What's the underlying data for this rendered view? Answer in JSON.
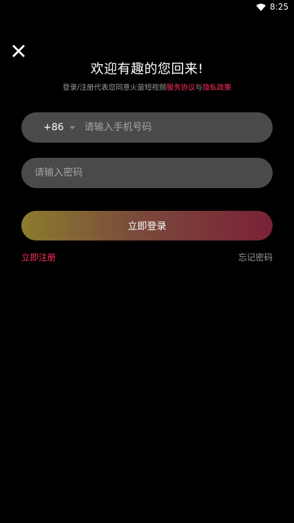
{
  "status_bar": {
    "time": "8:25",
    "wifi_icon": "wifi-icon"
  },
  "header": {
    "close_icon": "close-icon",
    "title": "欢迎有趣的您回来!"
  },
  "agreement": {
    "prefix": "登录/注册代表您同意火苗短视频",
    "service_link": "服务协议",
    "connector": "与",
    "privacy_link": "隐私政策",
    "link_color": "#ff2e5e"
  },
  "phone": {
    "country_code": "+86",
    "placeholder": "请输入手机号码",
    "value": ""
  },
  "password": {
    "placeholder": "请输入密码",
    "value": ""
  },
  "login_button": {
    "label": "立即登录"
  },
  "links": {
    "register": "立即注册",
    "forgot": "忘记密码"
  },
  "colors": {
    "background": "#000000",
    "input_bg": "#4a4a4a",
    "accent": "#ff2e5e"
  }
}
